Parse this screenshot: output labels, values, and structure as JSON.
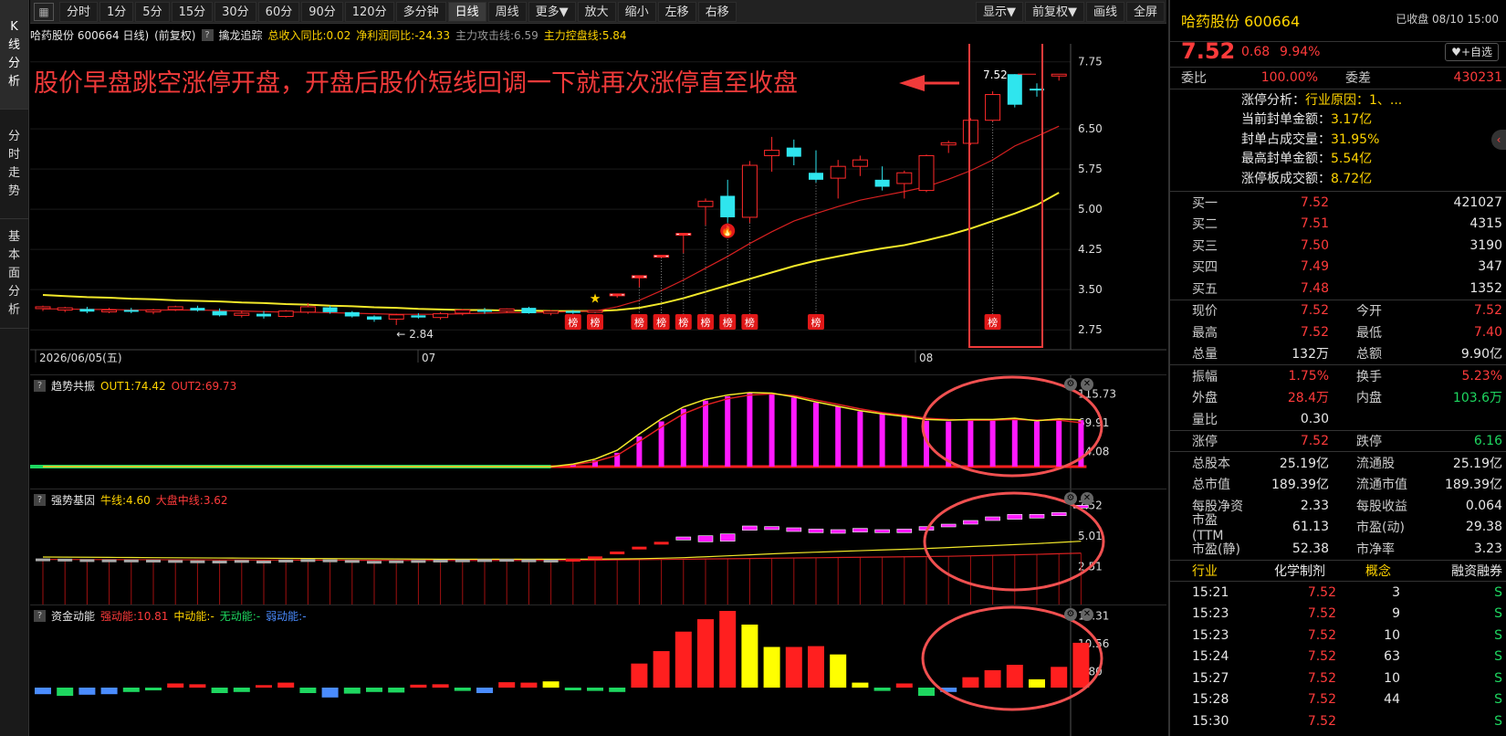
{
  "left_tabs": [
    "K线分析",
    "分时走势",
    "基本面分析"
  ],
  "toolbar": {
    "buttons": [
      "分时",
      "1分",
      "5分",
      "15分",
      "30分",
      "60分",
      "90分",
      "120分",
      "多分钟",
      "日线",
      "周线",
      "更多▼",
      "放大",
      "缩小",
      "左移",
      "右移"
    ],
    "active": "日线",
    "right_buttons": [
      "显示▼",
      "前复权▼",
      "画线",
      "全屏"
    ]
  },
  "infobar": {
    "stock": "哈药股份 600664 日线)",
    "adjust": "(前复权)",
    "indicator": "擒龙追踪",
    "revenue": "总收入同比:0.02",
    "profit": "净利润同比:-24.33",
    "attack": "主力攻击线:6.59",
    "control": "主力控盘线:5.84"
  },
  "colors": {
    "up": "#ff2a2a",
    "down": "#2fe5ee",
    "ma_yellow": "#f2e82a",
    "magenta": "#ff19ff",
    "green": "#1ed760",
    "blue": "#4a8cff"
  },
  "annotation": {
    "text": "股价早盘跳空涨停开盘，开盘后股价短线回调一下就再次涨停直至收盘"
  },
  "main_chart": {
    "price_ticks": [
      "7.75",
      "6.50",
      "5.75",
      "5.00",
      "4.25",
      "3.50",
      "2.75"
    ],
    "date_labels": [
      "2026/06/05(五)",
      "07",
      "08"
    ],
    "low_label": "2.84",
    "last_price_label": "7.52",
    "badge_text": "榜"
  },
  "chart_data": [
    {
      "type": "candlestick",
      "name": "日线",
      "ylim": [
        2.6,
        7.95
      ],
      "candles": [
        [
          3.15,
          3.2,
          3.1,
          3.18
        ],
        [
          3.12,
          3.18,
          3.08,
          3.16
        ],
        [
          3.14,
          3.18,
          3.06,
          3.09
        ],
        [
          3.1,
          3.16,
          3.06,
          3.12
        ],
        [
          3.12,
          3.16,
          3.06,
          3.09
        ],
        [
          3.1,
          3.14,
          3.04,
          3.12
        ],
        [
          3.13,
          3.2,
          3.1,
          3.18
        ],
        [
          3.16,
          3.2,
          3.09,
          3.11
        ],
        [
          3.1,
          3.15,
          3.0,
          3.02
        ],
        [
          3.02,
          3.1,
          2.98,
          3.06
        ],
        [
          3.05,
          3.1,
          2.96,
          3.0
        ],
        [
          3.0,
          3.12,
          2.98,
          3.1
        ],
        [
          3.08,
          3.25,
          3.05,
          3.18
        ],
        [
          3.17,
          3.2,
          3.05,
          3.08
        ],
        [
          3.08,
          3.1,
          2.98,
          3.0
        ],
        [
          3.0,
          3.02,
          2.9,
          2.94
        ],
        [
          2.95,
          3.05,
          2.84,
          3.03
        ],
        [
          3.02,
          3.06,
          2.96,
          2.98
        ],
        [
          2.98,
          3.08,
          2.94,
          3.05
        ],
        [
          3.06,
          3.14,
          3.02,
          3.12
        ],
        [
          3.12,
          3.16,
          3.05,
          3.1
        ],
        [
          3.1,
          3.15,
          3.06,
          3.14
        ],
        [
          3.16,
          3.18,
          3.05,
          3.06
        ],
        [
          3.06,
          3.12,
          3.02,
          3.1
        ],
        [
          3.1,
          3.12,
          3.05,
          3.08
        ],
        [
          3.1,
          3.12,
          3.08,
          3.11
        ],
        [
          3.42,
          3.42,
          3.35,
          3.42
        ],
        [
          3.72,
          3.76,
          3.55,
          3.76
        ],
        [
          4.14,
          4.14,
          4.1,
          4.14
        ],
        [
          4.55,
          4.55,
          4.18,
          4.55
        ],
        [
          5.05,
          5.2,
          4.7,
          5.15
        ],
        [
          5.25,
          5.55,
          4.75,
          4.85
        ],
        [
          4.85,
          5.9,
          4.75,
          5.82
        ],
        [
          6.0,
          6.35,
          5.7,
          6.1
        ],
        [
          6.15,
          6.3,
          5.82,
          5.98
        ],
        [
          5.68,
          6.1,
          5.5,
          5.55
        ],
        [
          5.58,
          5.92,
          5.2,
          5.8
        ],
        [
          5.8,
          6.0,
          5.62,
          5.92
        ],
        [
          5.55,
          5.8,
          5.35,
          5.42
        ],
        [
          5.48,
          5.72,
          5.2,
          5.68
        ],
        [
          5.35,
          6.02,
          5.32,
          6.0
        ],
        [
          6.2,
          6.28,
          6.05,
          6.24
        ],
        [
          6.23,
          6.7,
          6.2,
          6.66
        ],
        [
          6.66,
          7.2,
          6.64,
          7.14
        ],
        [
          7.52,
          7.52,
          6.9,
          6.95
        ],
        [
          7.25,
          7.35,
          7.1,
          7.22
        ]
      ],
      "last_candle": {
        "open": 7.52,
        "high": 7.52,
        "low": 7.4,
        "close": 7.52
      },
      "ma_red": [
        3.14,
        3.14,
        3.13,
        3.13,
        3.12,
        3.12,
        3.12,
        3.12,
        3.11,
        3.1,
        3.09,
        3.08,
        3.08,
        3.07,
        3.06,
        3.05,
        3.04,
        3.04,
        3.04,
        3.05,
        3.06,
        3.07,
        3.07,
        3.08,
        3.09,
        3.1,
        3.18,
        3.3,
        3.48,
        3.68,
        3.9,
        4.12,
        4.36,
        4.58,
        4.78,
        4.92,
        5.05,
        5.17,
        5.25,
        5.33,
        5.42,
        5.56,
        5.72,
        5.92,
        6.18,
        6.36,
        6.55
      ],
      "ma_yellow": [
        3.4,
        3.38,
        3.36,
        3.35,
        3.33,
        3.32,
        3.3,
        3.29,
        3.28,
        3.26,
        3.25,
        3.23,
        3.22,
        3.2,
        3.19,
        3.17,
        3.16,
        3.14,
        3.13,
        3.12,
        3.12,
        3.11,
        3.11,
        3.1,
        3.1,
        3.1,
        3.12,
        3.16,
        3.24,
        3.34,
        3.46,
        3.58,
        3.7,
        3.82,
        3.94,
        4.04,
        4.12,
        4.2,
        4.27,
        4.33,
        4.42,
        4.52,
        4.64,
        4.78,
        4.92,
        5.08,
        5.31
      ],
      "badge_days": [
        24,
        25,
        27,
        28,
        29,
        30,
        31,
        32,
        35,
        43
      ]
    },
    {
      "type": "bar",
      "name": "趋势共振",
      "legend": [
        "OUT1:74.42",
        "OUT2:69.73"
      ],
      "ticks": [
        "115.73",
        "69.91",
        "24.08"
      ],
      "ylim": [
        0,
        125
      ],
      "values": [
        0,
        0,
        0,
        0,
        0,
        0,
        0,
        0,
        0,
        0,
        0,
        0,
        0,
        0,
        0,
        0,
        0,
        0,
        0,
        0,
        0,
        0,
        0,
        0,
        3,
        10,
        22,
        48,
        72,
        92,
        105,
        112,
        118,
        116,
        110,
        102,
        96,
        88,
        84,
        80,
        73,
        72,
        74,
        74,
        76,
        72,
        75,
        74
      ],
      "out1": [
        0,
        0,
        0,
        0,
        0,
        0,
        0,
        0,
        0,
        0,
        0,
        0,
        0,
        0,
        0,
        0,
        0,
        0,
        0,
        0,
        0,
        0,
        0,
        0,
        4,
        12,
        26,
        52,
        76,
        95,
        107,
        114,
        118,
        117,
        111,
        103,
        96,
        89,
        84,
        80,
        75,
        74,
        75,
        75,
        77,
        73,
        76,
        74.42
      ],
      "out2": [
        0,
        0,
        0,
        0,
        0,
        0,
        0,
        0,
        0,
        0,
        0,
        0,
        0,
        0,
        0,
        0,
        0,
        0,
        0,
        0,
        0,
        0,
        0,
        0,
        3,
        8,
        18,
        40,
        63,
        84,
        98,
        108,
        114,
        116,
        113,
        106,
        99,
        92,
        86,
        82,
        77,
        75,
        74,
        74,
        75,
        74,
        74,
        69.73
      ]
    },
    {
      "type": "bar",
      "name": "强势基因",
      "legend": [
        "牛线:4.60",
        "大盘中线:3.62"
      ],
      "ticks": [
        "7.52",
        "5.01",
        "2.51"
      ],
      "ylim": [
        0,
        8.4
      ],
      "boxes": [
        [
          3.18,
          3.1
        ],
        [
          3.16,
          3.08
        ],
        [
          3.12,
          3.05
        ],
        [
          3.1,
          3.04
        ],
        [
          3.09,
          3.02
        ],
        [
          3.08,
          3.0
        ],
        [
          3.05,
          3.0
        ],
        [
          3.02,
          2.96
        ],
        [
          3.0,
          2.92
        ],
        [
          3.05,
          2.98
        ],
        [
          3.0,
          2.95
        ],
        [
          3.08,
          3.02
        ],
        [
          3.12,
          3.05
        ],
        [
          3.1,
          3.02
        ],
        [
          3.05,
          3.0
        ],
        [
          2.98,
          2.9
        ],
        [
          3.02,
          2.95
        ],
        [
          3.05,
          3.0
        ],
        [
          3.08,
          3.02
        ],
        [
          3.1,
          3.04
        ],
        [
          3.12,
          3.06
        ],
        [
          3.14,
          3.08
        ],
        [
          3.1,
          3.05
        ],
        [
          3.08,
          3.04
        ],
        [
          3.15,
          3.1
        ],
        [
          3.35,
          3.3
        ],
        [
          3.75,
          3.7
        ],
        [
          4.15,
          4.1
        ],
        [
          4.55,
          4.5
        ],
        [
          4.95,
          4.7
        ],
        [
          5.05,
          4.55
        ],
        [
          5.2,
          4.6
        ],
        [
          5.85,
          5.5
        ],
        [
          5.8,
          5.55
        ],
        [
          5.7,
          5.4
        ],
        [
          5.6,
          5.3
        ],
        [
          5.55,
          5.25
        ],
        [
          5.65,
          5.35
        ],
        [
          5.55,
          5.3
        ],
        [
          5.6,
          5.3
        ],
        [
          5.8,
          5.5
        ],
        [
          6.0,
          5.8
        ],
        [
          6.3,
          6.0
        ],
        [
          6.6,
          6.3
        ],
        [
          6.8,
          6.4
        ],
        [
          6.8,
          6.5
        ],
        [
          6.95,
          6.7
        ],
        [
          7.55,
          7.45
        ]
      ],
      "boxes_up_from": 24,
      "bull_line": [
        3.3,
        3.29,
        3.28,
        3.27,
        3.26,
        3.25,
        3.24,
        3.23,
        3.22,
        3.21,
        3.2,
        3.19,
        3.18,
        3.17,
        3.16,
        3.15,
        3.14,
        3.13,
        3.12,
        3.12,
        3.12,
        3.12,
        3.12,
        3.12,
        3.12,
        3.13,
        3.14,
        3.16,
        3.2,
        3.25,
        3.32,
        3.4,
        3.48,
        3.56,
        3.64,
        3.7,
        3.76,
        3.82,
        3.88,
        3.94,
        4.0,
        4.08,
        4.16,
        4.24,
        4.32,
        4.4,
        4.5,
        4.6
      ],
      "market_line": [
        3.1,
        3.1,
        3.09,
        3.09,
        3.08,
        3.08,
        3.07,
        3.07,
        3.06,
        3.06,
        3.05,
        3.05,
        3.04,
        3.04,
        3.03,
        3.03,
        3.02,
        3.02,
        3.02,
        3.02,
        3.02,
        3.02,
        3.02,
        3.02,
        3.02,
        3.04,
        3.06,
        3.08,
        3.1,
        3.12,
        3.14,
        3.16,
        3.18,
        3.2,
        3.22,
        3.24,
        3.26,
        3.28,
        3.3,
        3.32,
        3.34,
        3.36,
        3.4,
        3.44,
        3.48,
        3.52,
        3.57,
        3.62
      ]
    },
    {
      "type": "bar",
      "name": "资金动能",
      "legend": [
        "强动能:10.81",
        "中动能:-",
        "无动能:-",
        "弱动能:-"
      ],
      "ticks": [
        "17.31",
        "10.56",
        "3.80"
      ],
      "ylim": [
        0,
        18.5
      ],
      "values": [
        1.2,
        1.5,
        1.3,
        1.2,
        0.8,
        0.5,
        1.0,
        0.8,
        1.0,
        0.8,
        0.6,
        1.2,
        1.0,
        1.8,
        1.1,
        0.8,
        0.9,
        0.7,
        0.8,
        0.6,
        1.0,
        1.3,
        1.2,
        1.5,
        0.5,
        0.6,
        0.8,
        5.8,
        8.8,
        13.5,
        16.5,
        18.5,
        15.2,
        9.8,
        9.8,
        10.0,
        8.0,
        1.2,
        0.6,
        1.0,
        1.5,
        0.8,
        2.5,
        4.2,
        5.5,
        2.0,
        5.0,
        10.81
      ],
      "kinds": [
        "b",
        "g",
        "b",
        "b",
        "g",
        "g",
        "r",
        "r",
        "g",
        "g",
        "r",
        "r",
        "g",
        "b",
        "g",
        "g",
        "g",
        "r",
        "r",
        "g",
        "b",
        "r",
        "r",
        "y",
        "g",
        "g",
        "g",
        "r",
        "r",
        "r",
        "r",
        "r",
        "y",
        "y",
        "r",
        "r",
        "y",
        "y",
        "g",
        "r",
        "g",
        "b",
        "r",
        "r",
        "r",
        "y",
        "r",
        "r"
      ]
    }
  ],
  "right_panel": {
    "name": "哈药股份 600664",
    "status": "已收盘 08/10 15:00",
    "price": "7.52",
    "change": "0.68",
    "pct": "9.94%",
    "watch_btn": "+自选",
    "weibi_label": "委比",
    "weibi": "100.00%",
    "weicha_label": "委差",
    "weicha": "430231",
    "limit_analysis": [
      {
        "label": "涨停分析：",
        "value": "行业原因：1、..."
      },
      {
        "label": "当前封单金额：",
        "value": "3.17亿"
      },
      {
        "label": "封单占成交量：",
        "value": "31.95%"
      },
      {
        "label": "最高封单金额：",
        "value": "5.54亿"
      },
      {
        "label": "涨停板成交额：",
        "value": "8.72亿"
      }
    ],
    "bids": [
      {
        "label": "买一",
        "price": "7.52",
        "vol": "421027"
      },
      {
        "label": "买二",
        "price": "7.51",
        "vol": "4315"
      },
      {
        "label": "买三",
        "price": "7.50",
        "vol": "3190"
      },
      {
        "label": "买四",
        "price": "7.49",
        "vol": "347"
      },
      {
        "label": "买五",
        "price": "7.48",
        "vol": "1352"
      }
    ],
    "stats1": [
      [
        "现价",
        "7.52",
        "今开",
        "7.52"
      ],
      [
        "最高",
        "7.52",
        "最低",
        "7.40"
      ],
      [
        "总量",
        "132万",
        "总额",
        "9.90亿"
      ]
    ],
    "stats2": [
      [
        "振幅",
        "1.75%",
        "换手",
        "5.23%"
      ],
      [
        "外盘",
        "28.4万",
        "内盘",
        "103.6万"
      ],
      [
        "量比",
        "0.30",
        "",
        ""
      ]
    ],
    "limits": [
      "涨停",
      "7.52",
      "跌停",
      "6.16"
    ],
    "fundamentals": [
      [
        "总股本",
        "25.19亿",
        "流通股",
        "25.19亿"
      ],
      [
        "总市值",
        "189.39亿",
        "流通市值",
        "189.39亿"
      ],
      [
        "每股净资",
        "2.33",
        "每股收益",
        "0.064"
      ],
      [
        "市盈(TTM",
        "61.13",
        "市盈(动)",
        "29.38"
      ],
      [
        "市盈(静)",
        "52.38",
        "市净率",
        "3.23"
      ]
    ],
    "tabs": [
      "行业",
      "化学制剂",
      "概念",
      "融资融券"
    ],
    "ticks": [
      [
        "15:21",
        "7.52",
        "3",
        "S"
      ],
      [
        "15:23",
        "7.52",
        "9",
        "S"
      ],
      [
        "15:23",
        "7.52",
        "10",
        "S"
      ],
      [
        "15:24",
        "7.52",
        "63",
        "S"
      ],
      [
        "15:27",
        "7.52",
        "10",
        "S"
      ],
      [
        "15:28",
        "7.52",
        "44",
        "S"
      ],
      [
        "15:30",
        "7.52",
        "",
        "S"
      ]
    ]
  }
}
